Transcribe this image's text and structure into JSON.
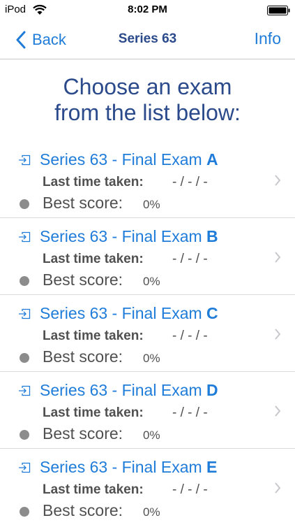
{
  "status_bar": {
    "carrier": "iPod",
    "time": "8:02 PM"
  },
  "nav": {
    "back_label": "Back",
    "title": "Series 63",
    "info_label": "Info"
  },
  "heading": {
    "line1": "Choose an exam",
    "line2": "from the list below:"
  },
  "colors": {
    "accent": "#1f7cd9",
    "title_navy": "#2b4a8b",
    "text_gray": "#505050",
    "dot_gray": "#8c8c8c"
  },
  "exams": [
    {
      "title": "Series 63 - Final Exam ",
      "letter": "A",
      "last_label": "Last time taken:",
      "last_value": "- / - / -",
      "best_label": "Best score:",
      "best_value": "0%"
    },
    {
      "title": "Series 63 - Final Exam ",
      "letter": "B",
      "last_label": "Last time taken:",
      "last_value": "- / - / -",
      "best_label": "Best score:",
      "best_value": "0%"
    },
    {
      "title": "Series 63 - Final Exam ",
      "letter": "C",
      "last_label": "Last time taken:",
      "last_value": "- / - / -",
      "best_label": "Best score:",
      "best_value": "0%"
    },
    {
      "title": "Series 63 - Final Exam ",
      "letter": "D",
      "last_label": "Last time taken:",
      "last_value": "- / - / -",
      "best_label": "Best score:",
      "best_value": "0%"
    },
    {
      "title": "Series 63 - Final Exam ",
      "letter": "E",
      "last_label": "Last time taken:",
      "last_value": "- / - / -",
      "best_label": "Best score:",
      "best_value": "0%"
    }
  ]
}
